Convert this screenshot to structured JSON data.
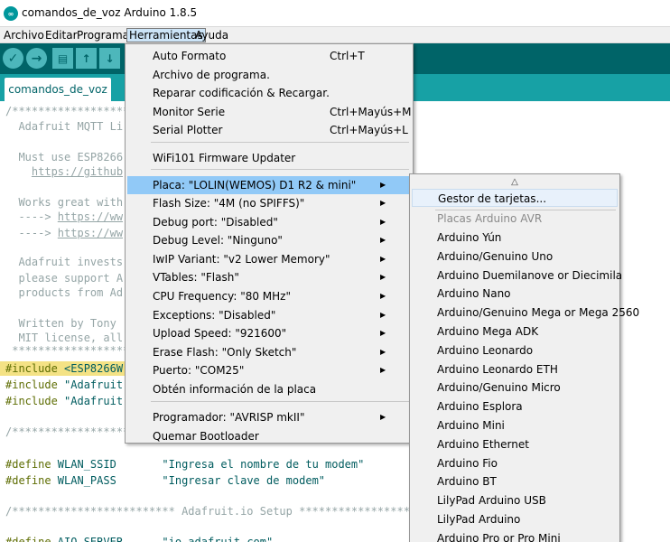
{
  "window": {
    "title": "comandos_de_voz Arduino 1.8.5"
  },
  "menubar": {
    "items": [
      "Archivo",
      "Editar",
      "Programa",
      "Herramientas",
      "Ayuda"
    ],
    "active": "Herramientas"
  },
  "toolbar": {
    "verify_icon": "check-icon",
    "upload_icon": "arrow-right-icon",
    "new_icon": "file-icon",
    "open_icon": "arrow-up-icon",
    "save_icon": "arrow-down-icon",
    "accent": "#006468",
    "button_color": "#4db7bb"
  },
  "tabs": [
    {
      "label": "comandos_de_voz"
    }
  ],
  "editor": {
    "lines": [
      "/*******************************",
      "  Adafruit MQTT Li",
      "",
      "  Must use ESP8266",
      "    https://github",
      "",
      "  Works great with",
      "  ----> https://ww",
      "  ----> https://ww",
      "",
      "  Adafruit invests",
      "  please support A",
      "  products from Ad",
      "",
      "  Written by Tony ",
      "  MIT license, all",
      " *******************************",
      "#include <ESP8266W",
      "#include \"Adafruit",
      "#include \"Adafruit",
      "",
      "/*******************************",
      "",
      "#define WLAN_SSID       \"Ingresa el nombre de tu modem\"",
      "#define WLAN_PASS       \"Ingresar clave de modem\"",
      "",
      "/************************* Adafruit.io Setup ******************************",
      "",
      "#define AIO_SERVER      \"io.adafruit.com\""
    ]
  },
  "tools_menu": {
    "items": [
      {
        "label": "Auto Formato",
        "shortcut": "Ctrl+T"
      },
      {
        "label": "Archivo de programa.",
        "shortcut": ""
      },
      {
        "label": "Reparar codificación & Recargar.",
        "shortcut": ""
      },
      {
        "label": "Monitor Serie",
        "shortcut": "Ctrl+Mayús+M"
      },
      {
        "label": "Serial Plotter",
        "shortcut": "Ctrl+Mayús+L"
      },
      {
        "label": "WiFi101 Firmware Updater",
        "shortcut": ""
      },
      {
        "label": "Placa: \"LOLIN(WEMOS) D1 R2 & mini\"",
        "submenu": true
      },
      {
        "label": "Flash Size: \"4M (no SPIFFS)\"",
        "submenu": true
      },
      {
        "label": "Debug port: \"Disabled\"",
        "submenu": true
      },
      {
        "label": "Debug Level: \"Ninguno\"",
        "submenu": true
      },
      {
        "label": "IwIP Variant: \"v2 Lower Memory\"",
        "submenu": true
      },
      {
        "label": "VTables: \"Flash\"",
        "submenu": true
      },
      {
        "label": "CPU Frequency: \"80 MHz\"",
        "submenu": true
      },
      {
        "label": "Exceptions: \"Disabled\"",
        "submenu": true
      },
      {
        "label": "Upload Speed: \"921600\"",
        "submenu": true
      },
      {
        "label": "Erase Flash: \"Only Sketch\"",
        "submenu": true
      },
      {
        "label": "Puerto: \"COM25\"",
        "submenu": true
      },
      {
        "label": "Obtén información de la placa",
        "submenu": false
      },
      {
        "label": "Programador: \"AVRISP mkII\"",
        "submenu": true
      },
      {
        "label": "Quemar Bootloader",
        "submenu": false
      }
    ],
    "hovered": "Placa: \"LOLIN(WEMOS) D1 R2 & mini\""
  },
  "board_menu": {
    "scroll_up": "△",
    "manager": "Gestor de tarjetas...",
    "section": "Placas Arduino AVR",
    "boards": [
      "Arduino Yún",
      "Arduino/Genuino Uno",
      "Arduino Duemilanove or Diecimila",
      "Arduino Nano",
      "Arduino/Genuino Mega or Mega 2560",
      "Arduino Mega ADK",
      "Arduino Leonardo",
      "Arduino Leonardo ETH",
      "Arduino/Genuino Micro",
      "Arduino Esplora",
      "Arduino Mini",
      "Arduino Ethernet",
      "Arduino Fio",
      "Arduino BT",
      "LilyPad Arduino USB",
      "LilyPad Arduino",
      "Arduino Pro or Pro Mini"
    ]
  }
}
